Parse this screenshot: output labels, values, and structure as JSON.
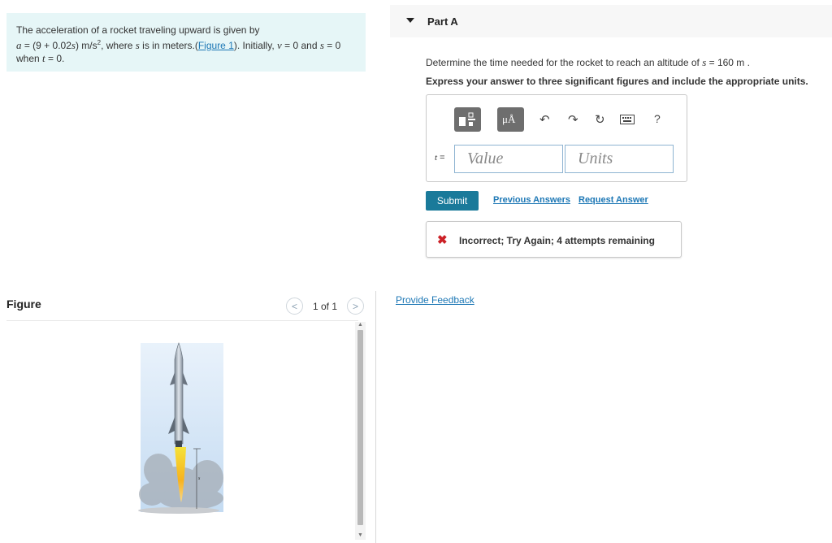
{
  "problem": {
    "line1": "The acceleration of a rocket traveling upward is given by",
    "eq_a": "a",
    "eq_mid": " = (9 + 0.02",
    "eq_s": "s",
    "eq_after": ") m/s",
    "eq_sup": "2",
    "eq_where": ", where ",
    "eq_s2": "s",
    "eq_tail": " is in meters.(",
    "figure_link": "Figure 1",
    "eq_init": "). Initially, ",
    "v_var": "v",
    "v_eq": " = 0 and ",
    "s_var": "s",
    "s_eq": " = 0",
    "line3_when": "when ",
    "t_var": "t",
    "t_eq": " = 0."
  },
  "figure": {
    "title": "Figure",
    "prev": "<",
    "next": ">",
    "counter": "1 of 1",
    "s_label": "s"
  },
  "part": {
    "title": "Part A",
    "question_pre": "Determine the time needed for the rocket to reach an altitude of ",
    "question_var": "s",
    "question_post": " = 160  m .",
    "instruction": "Express your answer to three significant figures and include the appropriate units."
  },
  "toolbar": {
    "units_btn": "μÅ",
    "help": "?"
  },
  "answer": {
    "t_label": "t",
    "t_eq": " =",
    "value_placeholder": "Value",
    "units_placeholder": "Units"
  },
  "actions": {
    "submit": "Submit",
    "previous_answers": "Previous Answers",
    "request_answer": "Request Answer"
  },
  "feedback": {
    "icon": "✖",
    "message": "Incorrect; Try Again; 4 attempts remaining"
  },
  "provide_feedback": "Provide Feedback",
  "colors": {
    "accent": "#1c77b5",
    "submit": "#1a7a9a",
    "error": "#cc2127",
    "problem_bg": "#e6f6f7"
  }
}
